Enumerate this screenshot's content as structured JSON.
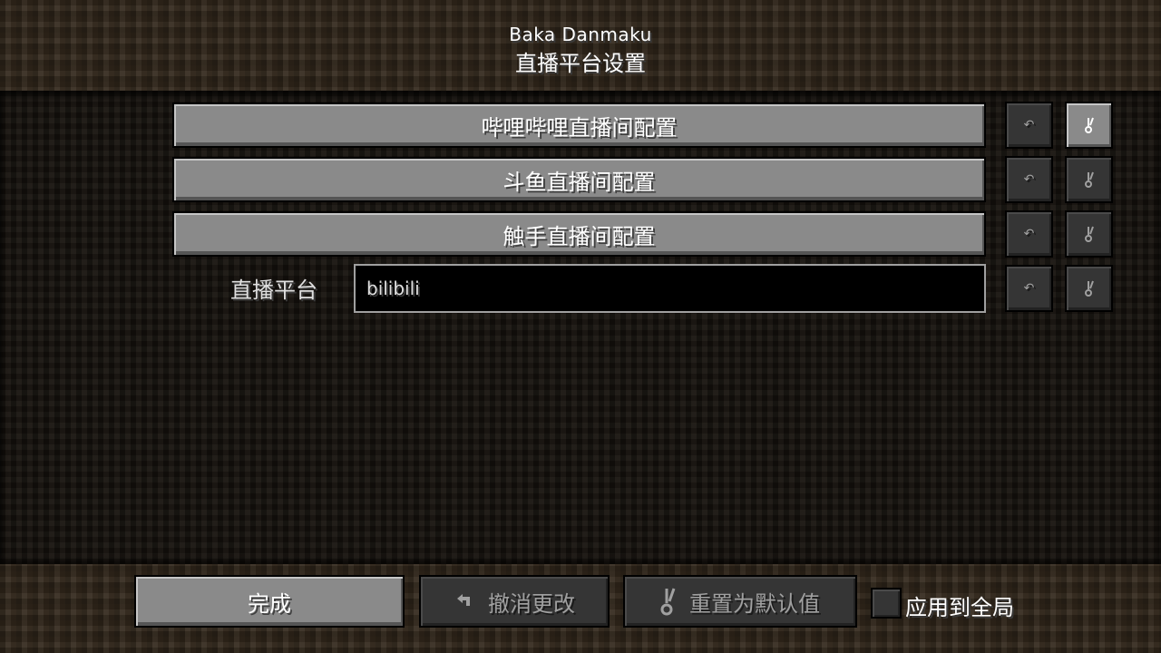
{
  "header": {
    "title": "Baka Danmaku",
    "subtitle": "直播平台设置"
  },
  "rows": [
    {
      "type": "button",
      "label": "哔哩哔哩直播间配置",
      "undo_icon": "undo-arrow-icon",
      "reset_icon": "reset-default-icon"
    },
    {
      "type": "button",
      "label": "斗鱼直播间配置",
      "undo_icon": "undo-arrow-icon",
      "reset_icon": "reset-default-icon"
    },
    {
      "type": "button",
      "label": "触手直播间配置",
      "undo_icon": "undo-arrow-icon",
      "reset_icon": "reset-default-icon"
    },
    {
      "type": "input",
      "label": "直播平台",
      "value": "bilibili",
      "undo_icon": "undo-arrow-icon",
      "reset_icon": "reset-default-icon"
    }
  ],
  "footer": {
    "done_label": "完成",
    "undo_label": "撤消更改",
    "reset_label": "重置为默认值",
    "apply_global_label": "应用到全局",
    "apply_global_checked": false
  },
  "colors": {
    "button_gray": "#8a8a8a",
    "button_disabled": "#353535",
    "input_bg": "#000000",
    "text_white": "#ffffff"
  }
}
